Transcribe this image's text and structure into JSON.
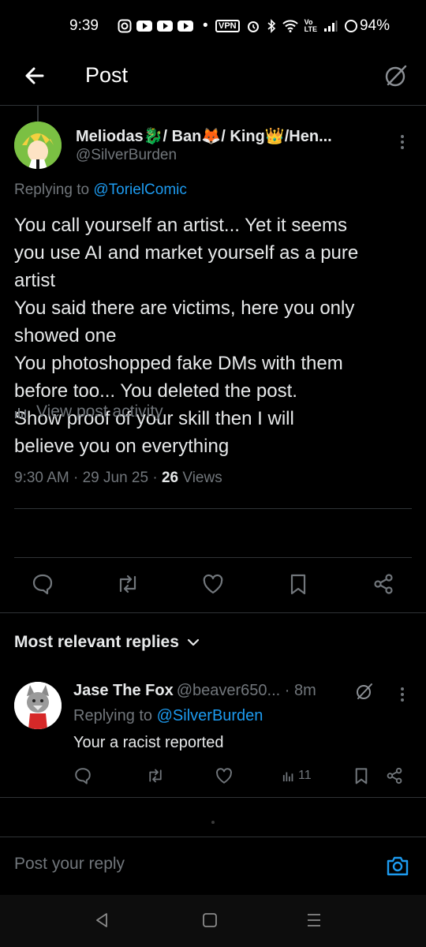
{
  "status_bar": {
    "time": "9:39",
    "battery": "94%",
    "vpn_label": "VPN",
    "dot": "•"
  },
  "header": {
    "title": "Post"
  },
  "post": {
    "author_name": "Meliodas🐉/ Ban🦊/ King👑/Hen...",
    "author_handle": "@SilverBurden",
    "replying_prefix": "Replying to",
    "replying_to": "@TorielComic",
    "body_lines": [
      "You call yourself an artist... Yet it seems",
      "you use AI and market yourself as a pure",
      "artist",
      "You said there are victims, here you only",
      "showed one",
      "You photoshopped fake DMs with them",
      "before too... You deleted the post.",
      "Show proof of your skill then I will",
      "believe you on everything"
    ],
    "timestamp": "9:30 AM · 29 Jun 25 · ",
    "views_count": "26",
    "views_label": " Views"
  },
  "view_activity": {
    "label": "View post activity"
  },
  "sort": {
    "label": "Most relevant replies"
  },
  "reply": {
    "name": "Jase The Fox",
    "handle_time": "@beaver650... · 8m",
    "replying_prefix": "Replying to",
    "replying_to": "@SilverBurden",
    "body": "Your a racist reported",
    "views": "11"
  },
  "composer": {
    "placeholder": "Post your reply"
  },
  "colors": {
    "accent": "#1d9bf0",
    "text": "#e7e9ea",
    "muted": "#71767b",
    "border": "#2f3336",
    "background": "#000000"
  }
}
